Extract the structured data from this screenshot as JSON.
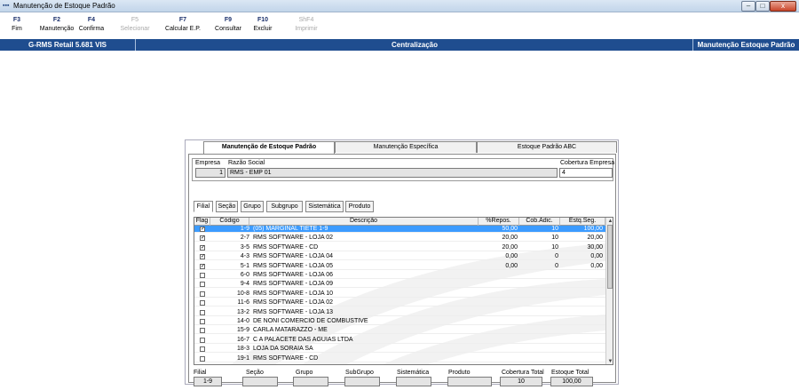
{
  "window": {
    "title": "Manutenção de Estoque Padrão",
    "min": "–",
    "max": "□",
    "close": "x"
  },
  "fkeys": [
    {
      "key": "F3",
      "label": "Fim",
      "enabled": true
    },
    {
      "key": "F2",
      "label": "Manutenção",
      "enabled": true
    },
    {
      "key": "F4",
      "label": "Confirma",
      "enabled": true
    },
    {
      "key": "F5",
      "label": "Selecionar",
      "enabled": false
    },
    {
      "key": "F7",
      "label": "Calcular E.P.",
      "enabled": true
    },
    {
      "key": "F9",
      "label": "Consultar",
      "enabled": true
    },
    {
      "key": "F10",
      "label": "Excluir",
      "enabled": true
    },
    {
      "key": "ShF4",
      "label": "Imprimir",
      "enabled": false
    }
  ],
  "status": {
    "left": "G-RMS Retail 5.681 VIS",
    "center": "Centralização",
    "right": "Manutenção Estoque Padrão"
  },
  "tabs": {
    "t1": "Manutenção de Estoque Padrão",
    "t2": "Manutenção Específica",
    "t3": "Estoque Padrão ABC"
  },
  "empresa": {
    "label": "Empresa",
    "value": "1",
    "razao_label": "Razão Social",
    "razao": "RMS - EMP 01",
    "cobertura_label": "Cobertura Empresa",
    "cobertura": "4"
  },
  "subtabs": {
    "filial": "Filial",
    "secao": "Seção",
    "grupo": "Grupo",
    "subgrupo": "Subgrupo",
    "sistematica": "Sistemática",
    "produto": "Produto"
  },
  "grid": {
    "headers": {
      "flag": "Flag",
      "codigo": "Código",
      "descricao": "Descrição",
      "repos": "%Repos.",
      "cob": "Cob.Adic.",
      "estq": "Estq.Seg."
    },
    "rows": [
      {
        "flag": true,
        "codigo": "1-9",
        "descricao": "(05) MARGINAL TIETE 1-9",
        "repos": "50,00",
        "cob": "10",
        "estq": "100,00",
        "selected": true
      },
      {
        "flag": true,
        "codigo": "2-7",
        "descricao": "RMS SOFTWARE - LOJA 02",
        "repos": "20,00",
        "cob": "10",
        "estq": "20,00"
      },
      {
        "flag": true,
        "codigo": "3-5",
        "descricao": "RMS SOFTWARE - CD",
        "repos": "20,00",
        "cob": "10",
        "estq": "30,00"
      },
      {
        "flag": true,
        "codigo": "4-3",
        "descricao": "RMS SOFTWARE - LOJA 04",
        "repos": "0,00",
        "cob": "0",
        "estq": "0,00"
      },
      {
        "flag": true,
        "codigo": "5-1",
        "descricao": "RMS SOFTWARE - LOJA 05",
        "repos": "0,00",
        "cob": "0",
        "estq": "0,00"
      },
      {
        "flag": false,
        "codigo": "6-0",
        "descricao": "RMS SOFTWARE - LOJA 06",
        "repos": "",
        "cob": "",
        "estq": ""
      },
      {
        "flag": false,
        "codigo": "9-4",
        "descricao": "RMS SOFTWARE - LOJA 09",
        "repos": "",
        "cob": "",
        "estq": ""
      },
      {
        "flag": false,
        "codigo": "10-8",
        "descricao": "RMS SOFTWARE - LOJA 10",
        "repos": "",
        "cob": "",
        "estq": ""
      },
      {
        "flag": false,
        "codigo": "11-6",
        "descricao": "RMS SOFTWARE - LOJA 02",
        "repos": "",
        "cob": "",
        "estq": ""
      },
      {
        "flag": false,
        "codigo": "13-2",
        "descricao": "RMS SOFTWARE - LOJA 13",
        "repos": "",
        "cob": "",
        "estq": ""
      },
      {
        "flag": false,
        "codigo": "14-0",
        "descricao": "DE NONI COMERCIO DE COMBUSTIVE",
        "repos": "",
        "cob": "",
        "estq": ""
      },
      {
        "flag": false,
        "codigo": "15-9",
        "descricao": "CARLA MATARAZZO - ME",
        "repos": "",
        "cob": "",
        "estq": ""
      },
      {
        "flag": false,
        "codigo": "16-7",
        "descricao": "C A PALACETE DAS AGUIAS LTDA",
        "repos": "",
        "cob": "",
        "estq": ""
      },
      {
        "flag": false,
        "codigo": "18-3",
        "descricao": "LOJA DA SORAIA SA",
        "repos": "",
        "cob": "",
        "estq": ""
      },
      {
        "flag": false,
        "codigo": "19-1",
        "descricao": "RMS SOFTWARE  -  CD",
        "repos": "",
        "cob": "",
        "estq": ""
      }
    ]
  },
  "footer": {
    "filial_label": "Filial",
    "filial": "1-9",
    "secao_label": "Seção",
    "secao": "",
    "grupo_label": "Grupo",
    "grupo": "",
    "subgrupo_label": "SubGrupo",
    "subgrupo": "",
    "sistematica_label": "Sistemática",
    "sistematica": "",
    "produto_label": "Produto",
    "produto": "",
    "cobtotal_label": "Cobertura Total",
    "cobtotal": "10",
    "estqtotal_label": "Estoque Total",
    "estqtotal": "100,00"
  }
}
